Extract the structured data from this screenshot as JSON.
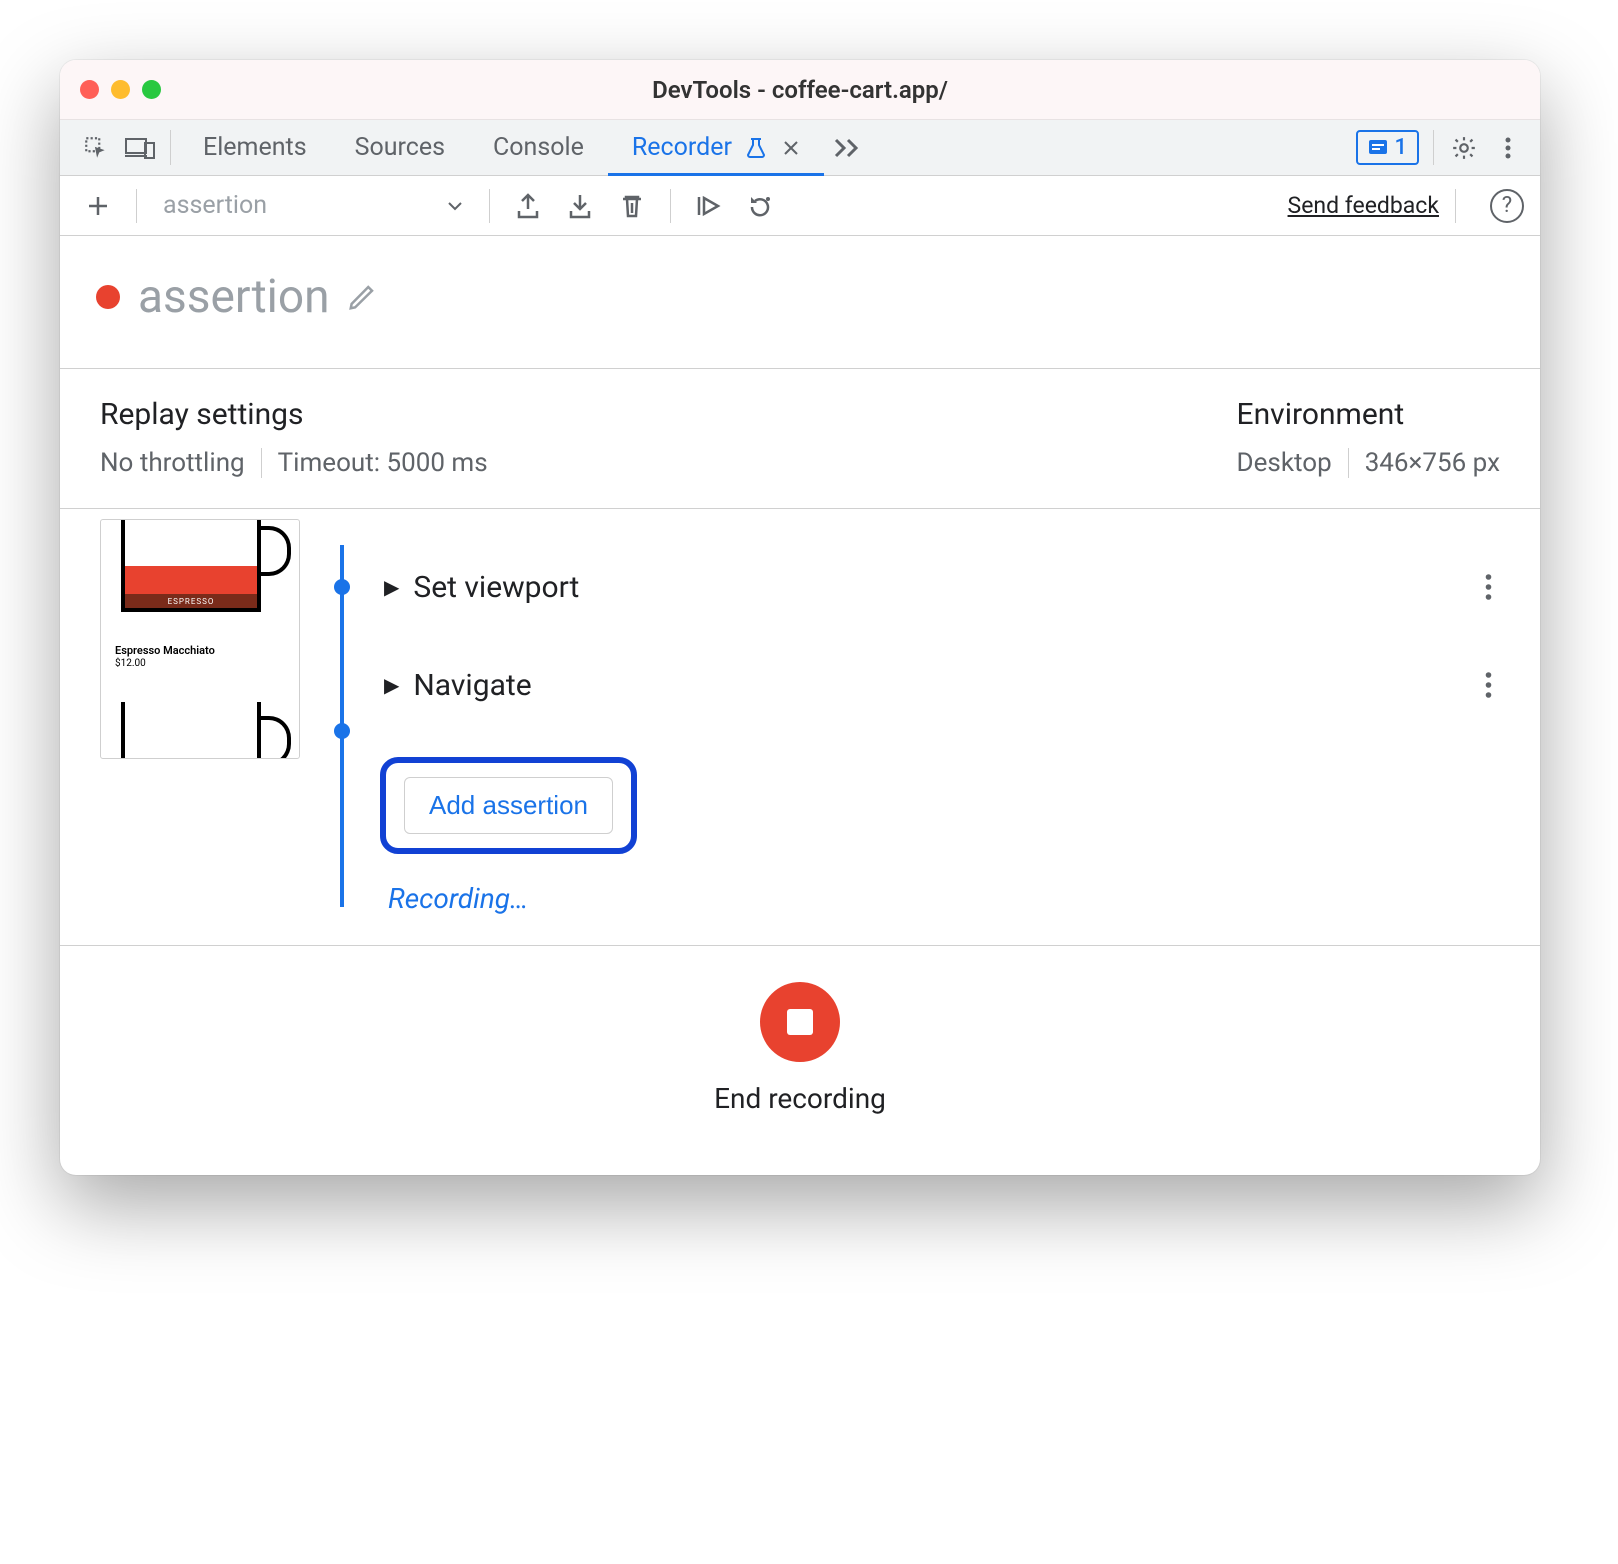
{
  "window": {
    "title": "DevTools - coffee-cart.app/"
  },
  "tabs": {
    "items": [
      "Elements",
      "Sources",
      "Console",
      "Recorder"
    ],
    "active_index": 3,
    "issues_count": "1"
  },
  "toolbar": {
    "recording_name": "assertion",
    "send_feedback": "Send feedback"
  },
  "title": {
    "name": "assertion"
  },
  "replay": {
    "heading": "Replay settings",
    "throttling": "No throttling",
    "timeout": "Timeout: 5000 ms"
  },
  "environment": {
    "heading": "Environment",
    "device": "Desktop",
    "viewport": "346×756 px"
  },
  "thumbnail": {
    "product_name": "Espresso Macchiato",
    "price": "$12.00",
    "band_text": "ESPRESSO"
  },
  "steps": [
    {
      "label": "Set viewport"
    },
    {
      "label": "Navigate"
    }
  ],
  "add_assertion": {
    "label": "Add assertion"
  },
  "recording_status": "Recording…",
  "footer": {
    "end_label": "End recording"
  }
}
